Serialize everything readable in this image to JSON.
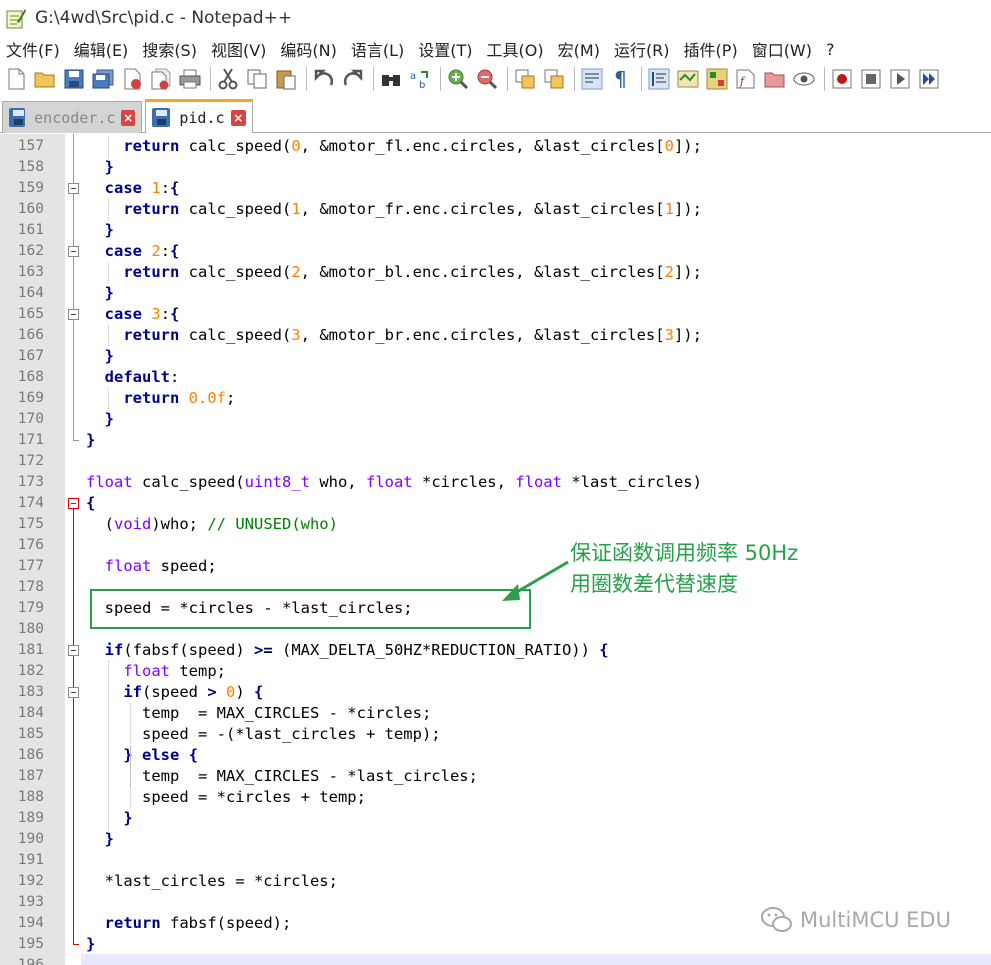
{
  "window": {
    "title": "G:\\4wd\\Src\\pid.c - Notepad++"
  },
  "menu": [
    "文件(F)",
    "编辑(E)",
    "搜索(S)",
    "视图(V)",
    "编码(N)",
    "语言(L)",
    "设置(T)",
    "工具(O)",
    "宏(M)",
    "运行(R)",
    "插件(P)",
    "窗口(W)",
    "?"
  ],
  "toolbar_icons": [
    "new-file-icon",
    "open-file-icon",
    "save-icon",
    "save-all-icon",
    "close-icon",
    "close-all-icon",
    "print-icon",
    "cut-icon",
    "copy-icon",
    "paste-icon",
    "undo-icon",
    "redo-icon",
    "find-icon",
    "replace-icon",
    "zoom-in-icon",
    "zoom-out-icon",
    "sync-vertical-icon",
    "sync-horizontal-icon",
    "word-wrap-icon",
    "show-all-chars-icon",
    "indent-guide-icon",
    "document-map-icon",
    "function-list-icon",
    "folder-as-workspace-icon",
    "doc-switcher-icon",
    "monitoring-icon",
    "record-macro-icon",
    "stop-macro-icon",
    "play-macro-icon",
    "run-macro-multiple-icon"
  ],
  "tabs": [
    {
      "label": "encoder.c",
      "active": false
    },
    {
      "label": "pid.c",
      "active": true
    }
  ],
  "lines": [
    {
      "n": "157",
      "code": "    return calc_speed(0, &motor_fl.enc.circles, &last_circles[0]);"
    },
    {
      "n": "158",
      "code": "  }"
    },
    {
      "n": "159",
      "code": "  case 1:{"
    },
    {
      "n": "160",
      "code": "    return calc_speed(1, &motor_fr.enc.circles, &last_circles[1]);"
    },
    {
      "n": "161",
      "code": "  }"
    },
    {
      "n": "162",
      "code": "  case 2:{"
    },
    {
      "n": "163",
      "code": "    return calc_speed(2, &motor_bl.enc.circles, &last_circles[2]);"
    },
    {
      "n": "164",
      "code": "  }"
    },
    {
      "n": "165",
      "code": "  case 3:{"
    },
    {
      "n": "166",
      "code": "    return calc_speed(3, &motor_br.enc.circles, &last_circles[3]);"
    },
    {
      "n": "167",
      "code": "  }"
    },
    {
      "n": "168",
      "code": "  default:"
    },
    {
      "n": "169",
      "code": "    return 0.0f;"
    },
    {
      "n": "170",
      "code": "  }"
    },
    {
      "n": "171",
      "code": "}"
    },
    {
      "n": "172",
      "code": ""
    },
    {
      "n": "173",
      "code": "float calc_speed(uint8_t who, float *circles, float *last_circles)"
    },
    {
      "n": "174",
      "code": "{"
    },
    {
      "n": "175",
      "code": "  (void)who; // UNUSED(who)"
    },
    {
      "n": "176",
      "code": ""
    },
    {
      "n": "177",
      "code": "  float speed;"
    },
    {
      "n": "178",
      "code": ""
    },
    {
      "n": "179",
      "code": "  speed = *circles - *last_circles;"
    },
    {
      "n": "180",
      "code": ""
    },
    {
      "n": "181",
      "code": "  if(fabsf(speed) >= (MAX_DELTA_50HZ*REDUCTION_RATIO)) {"
    },
    {
      "n": "182",
      "code": "    float temp;"
    },
    {
      "n": "183",
      "code": "    if(speed > 0) {"
    },
    {
      "n": "184",
      "code": "      temp  = MAX_CIRCLES - *circles;"
    },
    {
      "n": "185",
      "code": "      speed = -(*last_circles + temp);"
    },
    {
      "n": "186",
      "code": "    } else {"
    },
    {
      "n": "187",
      "code": "      temp  = MAX_CIRCLES - *last_circles;"
    },
    {
      "n": "188",
      "code": "      speed = *circles + temp;"
    },
    {
      "n": "189",
      "code": "    }"
    },
    {
      "n": "190",
      "code": "  }"
    },
    {
      "n": "191",
      "code": ""
    },
    {
      "n": "192",
      "code": "  *last_circles = *circles;"
    },
    {
      "n": "193",
      "code": ""
    },
    {
      "n": "194",
      "code": "  return fabsf(speed);"
    },
    {
      "n": "195",
      "code": "}"
    },
    {
      "n": "196",
      "code": ""
    }
  ],
  "annotation": {
    "line1": "保证函数调用频率 50Hz",
    "line2": "用圈数差代替速度",
    "color": "#27a04a"
  },
  "watermark": "MultiMCU EDU",
  "colors": {
    "keyword": "#00008b",
    "type": "#8000ff",
    "number": "#ff8000",
    "comment": "#008000",
    "gutter": "#e4e4e4",
    "fold_marker": "#d00000"
  }
}
